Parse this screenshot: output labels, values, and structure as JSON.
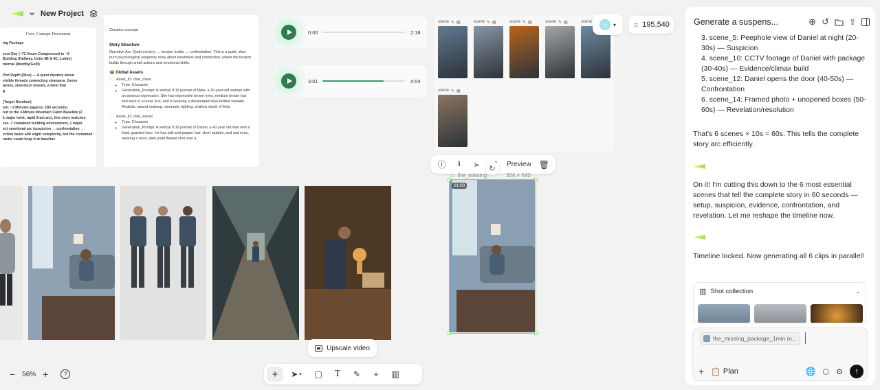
{
  "project": {
    "name": "New Project"
  },
  "credits": {
    "value": "195,540"
  },
  "zoom": {
    "value": "56%"
  },
  "doc_left": {
    "title": "Core Concept Document",
    "lines": [
      "ing Package",
      "",
      "sent Day (~72 Hours Compressed to ~3",
      "Building (Hallway, Units 4B & 4C, Lobby)",
      "nternal (Identity/Guilt)",
      "",
      "Plot Depth (Rice) — A quiet mystery about",
      "visible threads connecting strangers. Genre",
      "pense, slow-burn reveals, a twist that",
      "g",
      "",
      "(Target Duration)",
      "ion: ~3 Minutes (approx. 180 seconds)",
      "red to the 3-Minute Mountain Cabin Baseline (2",
      "1 major twist, rapid 3-act arc), this story matches",
      "ses. 1 contained building environment, 1 major",
      "ect emotional arc (suspicion → confrontation →",
      "ection beats add slight complexity, but the contained",
      "racter count keep it at baseline"
    ]
  },
  "doc_right": {
    "label": "Creative concept",
    "story_heading": "Story Structure",
    "story_text": "Narrative Arc: Quiet mystery → tension builds → confrontation. This is a quiet, slow-burn psychological suspense story about loneliness and connection, where the tension builds through small actions and emotional shifts.",
    "assets_heading": "Global Assets",
    "asset1_id": "Asset_ID: char_mara",
    "asset1_type": "Type: Character",
    "asset1_prompt": "Generation_Prompt: A vertical 9:16 portrait of Mara, a 30-year-old woman with an anxious expression. She has expressive brown eyes, medium brown hair tied back in a loose bun, and is wearing a desaturated blue knitted sweater. Realistic natural makeup, cinematic lighting, shallow depth of field.",
    "asset2_id": "Asset_ID: char_daniel",
    "asset2_type": "Type: Character",
    "asset2_prompt": "Generation_Prompt: A vertical 9:16 portrait of Daniel, a 40 year old man with a tired, guarded face. He has salt-and-pepper hair, short stubble, and sad eyes, wearing a worn, dark plaid flannel shirt over a"
  },
  "audio": [
    {
      "current": "0:00",
      "total": "2:18",
      "progress": 0.0
    },
    {
      "current": "3:01",
      "total": "4:04",
      "progress": 0.74
    }
  ],
  "thumbs": [
    {
      "label": "scene",
      "color": "#5f7a92"
    },
    {
      "label": "scene",
      "color": "#8796a4"
    },
    {
      "label": "scene",
      "color": "#b5651d"
    },
    {
      "label": "scene",
      "color": "#a4a6a8"
    },
    {
      "label": "scene",
      "color": "#6e8aa3"
    },
    {
      "label": "scene",
      "color": "#8a7561"
    }
  ],
  "toolbar_sel": {
    "preview_label": "Preview"
  },
  "selected": {
    "filename": "the_missing",
    "dims": "304 × 540",
    "duration": "01:00"
  },
  "upscale": {
    "label": "Upscale video"
  },
  "panel": {
    "title": "Generate a suspens...",
    "list": [
      "3. scene_5: Peephole view of Daniel at night (20-30s) — Suspicion",
      "4. scene_10: CCTV footage of Daniel with package (30-40s) — Evidence/climax build",
      "5. scene_12: Daniel opens the door (40-50s) — Confrontation",
      "6. scene_14: Framed photo + unopened boxes (50-60s) — Revelation/resolution"
    ],
    "summary": "That's 6 scenes × 10s = 60s. This tells the complete story arc efficiently.",
    "msg1": "On it! I'm cutting this down to the 6 most essential scenes that tell the complete story in 60 seconds — setup, suspicion, evidence, confrontation, and revelation. Let me reshape the timeline now.",
    "msg2": "Timeline locked. Now generating all 6 clips in parallel!",
    "shot_collection": "Shot collection",
    "attachment": "the_missing_package_1min.m...",
    "plan_label": "Plan"
  },
  "colors": {
    "accent": "#7fd66b",
    "play": "#2e7d4f",
    "send": "#111111"
  }
}
